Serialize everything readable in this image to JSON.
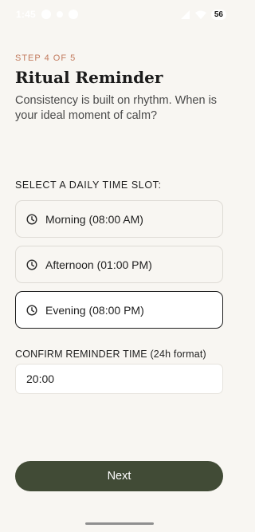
{
  "status_bar": {
    "time": "1:45",
    "battery": "56"
  },
  "header": {
    "step": "STEP 4 OF 5",
    "title": "Ritual Reminder",
    "subtitle": "Consistency is built on rhythm. When is your ideal moment of calm?"
  },
  "time_slots": {
    "label": "SELECT A DAILY TIME SLOT:",
    "selected": "Evening (08:00 PM)",
    "options": [
      {
        "label": "Morning (08:00 AM)",
        "icon": "clock-icon"
      },
      {
        "label": "Afternoon (01:00 PM)",
        "icon": "clock-icon"
      },
      {
        "label": "Evening (08:00 PM)",
        "icon": "clock-icon"
      }
    ]
  },
  "confirm": {
    "label": "CONFIRM REMINDER TIME (24h format)",
    "value": "20:00"
  },
  "actions": {
    "next_label": "Next"
  },
  "colors": {
    "accent": "#c27b5e",
    "primary_button": "#414b36",
    "background": "#f8f6f2"
  }
}
